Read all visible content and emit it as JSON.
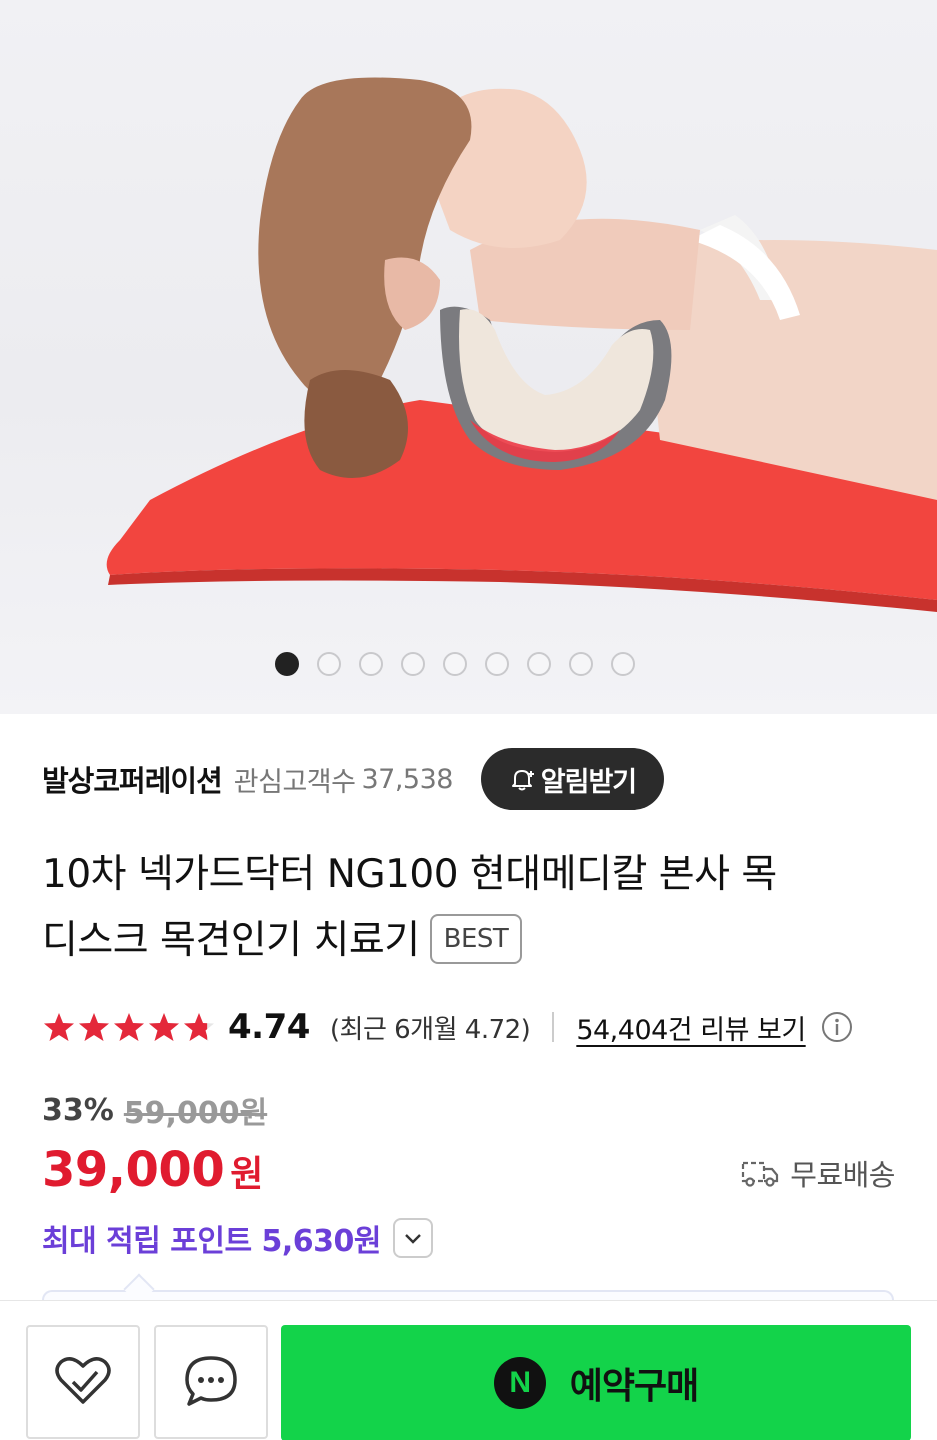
{
  "carousel": {
    "total": 9,
    "active": 0
  },
  "seller": {
    "name": "발상코퍼레이션",
    "fans_label": "관심고객수",
    "fans_count": "37,538",
    "alarm_label": "알림받기"
  },
  "product": {
    "title_line1": "10차 넥가드닥터 NG100 현대메디칼 본사 목",
    "title_line2": "디스크 목견인기 치료기",
    "badge": "BEST"
  },
  "rating": {
    "stars": 4.74,
    "value": "4.74",
    "recent": "(최근 6개월 4.72)",
    "review_link": "54,404건 리뷰 보기"
  },
  "price": {
    "discount": "33%",
    "original": "59,000원",
    "sale": "39,000",
    "currency": "원",
    "shipping": "무료배송",
    "points": "최대 적립 포인트 5,630원"
  },
  "bottom_bar": {
    "buy_label": "예약구매",
    "n_logo": "N"
  },
  "colors": {
    "price_red": "#e01b2f",
    "points_purple": "#6b3fd8",
    "buy_green": "#13d34a",
    "star_red": "#e4283a"
  }
}
